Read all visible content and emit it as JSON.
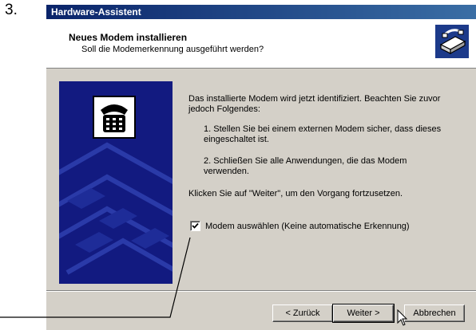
{
  "step_number": "3.",
  "window": {
    "title": "Hardware-Assistent"
  },
  "header": {
    "title": "Neues Modem installieren",
    "subtitle": "Soll die Modemerkennung ausgeführt werden?"
  },
  "body": {
    "paragraph1": "Das installierte Modem wird jetzt identifiziert. Beachten Sie zuvor jedoch Folgendes:",
    "item1": "1. Stellen Sie bei einem externen Modem sicher, dass dieses eingeschaltet ist.",
    "item2": "2. Schließen Sie alle Anwendungen, die das Modem verwenden.",
    "paragraph2": "Klicken Sie auf \"Weiter\", um den Vorgang fortzusetzen.",
    "checkbox_label": "Modem auswählen (Keine automatische Erkennung)",
    "checkbox_checked": true
  },
  "buttons": {
    "back": "< Zurück",
    "next": "Weiter >",
    "cancel": "Abbrechen"
  },
  "icons": {
    "header": "modem-wizard-icon",
    "left_panel": "telephone-icon"
  }
}
